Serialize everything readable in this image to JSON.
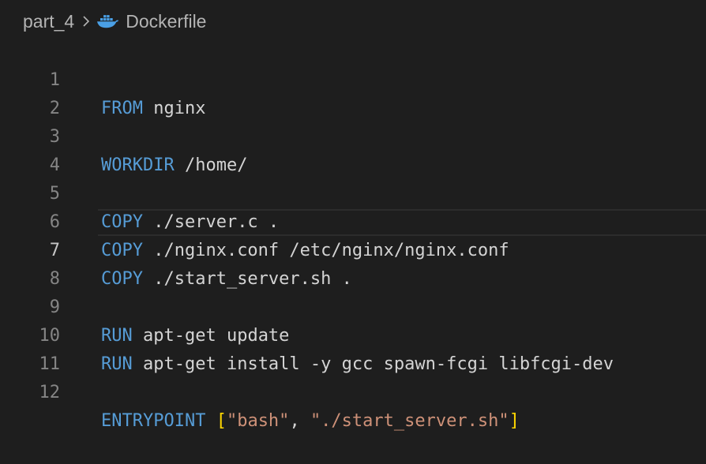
{
  "breadcrumb": {
    "folder": "part_4",
    "file": "Dockerfile"
  },
  "icons": {
    "separator": "chevron-right-icon",
    "file_icon": "docker-whale-icon"
  },
  "editor": {
    "current_line": 7,
    "lines": [
      {
        "number": "1",
        "keyword": "FROM",
        "args": " nginx"
      },
      {
        "number": "2"
      },
      {
        "number": "3",
        "keyword": "WORKDIR",
        "args": " /home/"
      },
      {
        "number": "4"
      },
      {
        "number": "5",
        "keyword": "COPY",
        "args": " ./server.c ."
      },
      {
        "number": "6",
        "keyword": "COPY",
        "args": " ./nginx.conf /etc/nginx/nginx.conf"
      },
      {
        "number": "7",
        "keyword": "COPY",
        "args": " ./start_server.sh ."
      },
      {
        "number": "8"
      },
      {
        "number": "9",
        "keyword": "RUN",
        "args": " apt-get update"
      },
      {
        "number": "10",
        "keyword": "RUN",
        "args": " apt-get install -y gcc spawn-fcgi libfcgi-dev"
      },
      {
        "number": "11"
      },
      {
        "number": "12",
        "keyword": "ENTRYPOINT",
        "space": " ",
        "open_bracket": "[",
        "str1": "\"bash\"",
        "comma": ", ",
        "str2": "\"./start_server.sh\"",
        "close_bracket": "]"
      }
    ]
  },
  "colors": {
    "background": "#1e1e1e",
    "keyword": "#569cd6",
    "text": "#d4d4d4",
    "string": "#ce9178",
    "bracket": "#ffd700",
    "line_number": "#858585",
    "line_number_active": "#c6c6c6",
    "docker_icon": "#4aa0e6"
  }
}
